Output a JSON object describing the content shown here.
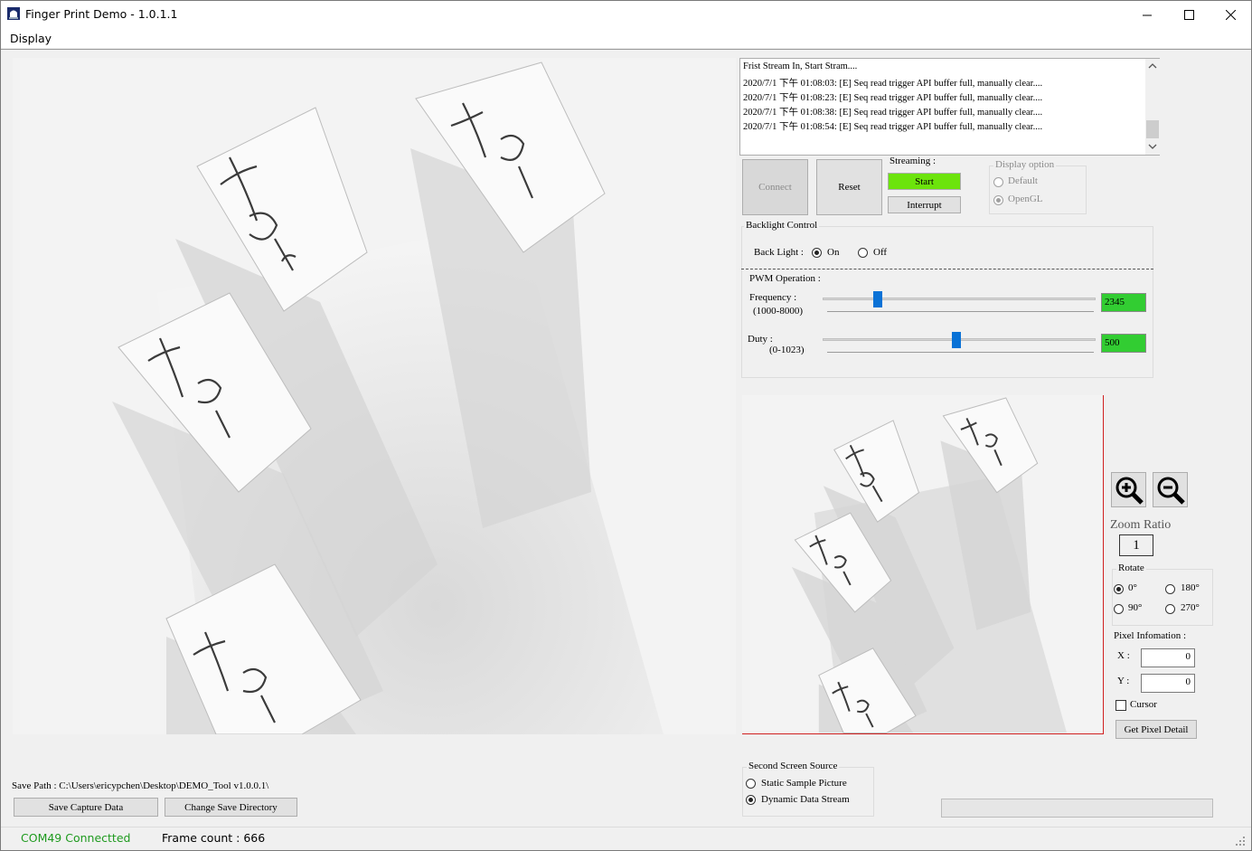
{
  "window": {
    "title": "Finger Print Demo - 1.0.1.1"
  },
  "menu": {
    "items": [
      "Display"
    ]
  },
  "main_image": {
    "alt_tags": [
      "left",
      "left",
      "left",
      "left"
    ]
  },
  "log": {
    "lines": [
      "Frist Stream In, Start Stram....",
      "2020/7/1 下午 01:08:03: [E] Seq read trigger API buffer full, manually clear....",
      "2020/7/1 下午 01:08:23: [E] Seq read trigger API buffer full, manually clear....",
      "2020/7/1 下午 01:08:38: [E] Seq read trigger API buffer full, manually clear....",
      "2020/7/1 下午 01:08:54: [E] Seq read trigger API buffer full, manually clear...."
    ]
  },
  "controls": {
    "connect": "Connect",
    "reset": "Reset",
    "streaming_label": "Streaming :",
    "start": "Start",
    "interrupt": "Interrupt",
    "display_option": {
      "title": "Display option",
      "options": [
        "Default",
        "OpenGL"
      ],
      "selected": "OpenGL"
    }
  },
  "backlight": {
    "title": "Backlight Control",
    "label": "Back Light :",
    "on": "On",
    "off": "Off",
    "selected": "On"
  },
  "pwm": {
    "title": "PWM Operation :",
    "frequency_label": "Frequency :",
    "frequency_range": "(1000-8000)",
    "frequency_value": "2345",
    "frequency_min": 1000,
    "frequency_max": 8000,
    "duty_label": "Duty :",
    "duty_range": "(0-1023)",
    "duty_value": "500",
    "duty_min": 0,
    "duty_max": 1023
  },
  "zoom": {
    "label": "Zoom Ratio",
    "value": "1"
  },
  "rotate": {
    "title": "Rotate",
    "options": [
      "0°",
      "180°",
      "90°",
      "270°"
    ],
    "selected": "0°"
  },
  "pixel": {
    "title": "Pixel Infomation :",
    "x_label": "X :",
    "x_value": "0",
    "y_label": "Y :",
    "y_value": "0",
    "cursor_label": "Cursor",
    "get_detail": "Get Pixel Detail"
  },
  "save": {
    "path_label": "Save Path : C:\\Users\\ericypchen\\Desktop\\DEMO_Tool v1.0.0.1\\",
    "save_button": "Save Capture Data",
    "change_dir_button": "Change Save Directory"
  },
  "second_screen": {
    "title": "Second Screen Source",
    "options": [
      "Static Sample Picture",
      "Dynamic Data Stream"
    ],
    "selected": "Dynamic Data Stream"
  },
  "status": {
    "connection": "COM49 Connectted",
    "frame_count": "Frame count : 666"
  },
  "colors": {
    "accent_green": "#32cd32",
    "status_green": "#1e9a1e",
    "slider_blue": "#0a72d6"
  }
}
